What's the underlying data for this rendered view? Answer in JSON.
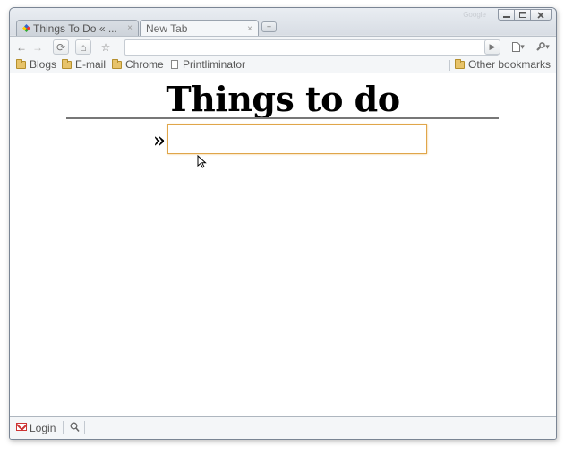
{
  "window": {
    "brand": "Google",
    "controls": [
      "minimize-icon",
      "maximize-icon",
      "close-icon"
    ]
  },
  "tabs": [
    {
      "title": "Things To Do « ...",
      "close": "×",
      "active": false
    },
    {
      "title": "New Tab",
      "close": "×",
      "active": true
    }
  ],
  "newtab": {
    "icon": "plus-icon",
    "glyph": "+"
  },
  "toolbar": {
    "back": "←",
    "forward": "→",
    "reload": "⟳",
    "home": "⌂",
    "star": "☆",
    "omnibox_value": "",
    "go": "▶",
    "page_menu": "▾",
    "wrench_menu": "▾"
  },
  "bookmarks": [
    {
      "label": "Blogs",
      "type": "folder"
    },
    {
      "label": "E-mail",
      "type": "folder"
    },
    {
      "label": "Chrome",
      "type": "folder"
    },
    {
      "label": "Printliminator",
      "type": "page"
    }
  ],
  "other_bookmarks": "Other bookmarks",
  "page": {
    "heading": "Things to do",
    "prompt": "»",
    "task_input_value": "",
    "accent": "#e0a64a"
  },
  "statusbar": {
    "login": "Login",
    "icons": [
      "gmail-icon",
      "search-icon"
    ]
  }
}
